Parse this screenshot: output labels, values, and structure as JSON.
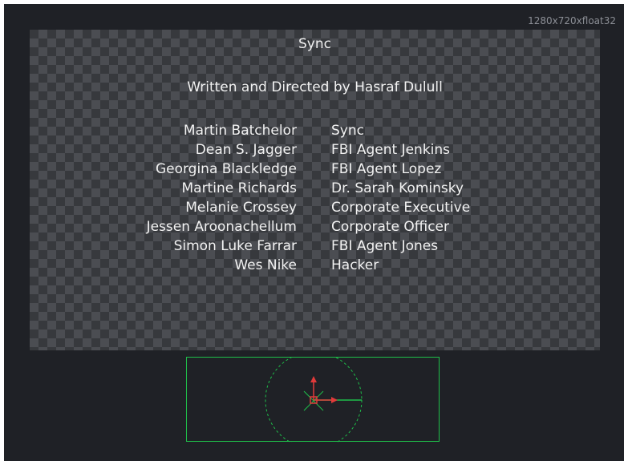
{
  "viewer": {
    "resolution_label": "1280x720xfloat32"
  },
  "credits": {
    "title": "Sync",
    "subtitle": "Written and Directed by Hasraf Dulull",
    "rows": [
      {
        "actor": "Martin Batchelor",
        "role": "Sync"
      },
      {
        "actor": "Dean S. Jagger",
        "role": "FBI Agent Jenkins"
      },
      {
        "actor": "Georgina Blackledge",
        "role": "FBI Agent Lopez"
      },
      {
        "actor": "Martine Richards",
        "role": "Dr. Sarah Kominsky"
      },
      {
        "actor": "Melanie Crossey",
        "role": "Corporate Executive"
      },
      {
        "actor": "Jessen Aroonachellum",
        "role": "Corporate Officer"
      },
      {
        "actor": "Simon Luke Farrar",
        "role": "FBI Agent Jones"
      },
      {
        "actor": "Wes Nike",
        "role": "Hacker"
      }
    ]
  },
  "colors": {
    "viewer_bg": "#1f2126",
    "checker_dark": "#37393d",
    "checker_light": "#4b4d52",
    "widget_green": "#1fbf4a",
    "gizmo_red": "#e03a3a"
  }
}
